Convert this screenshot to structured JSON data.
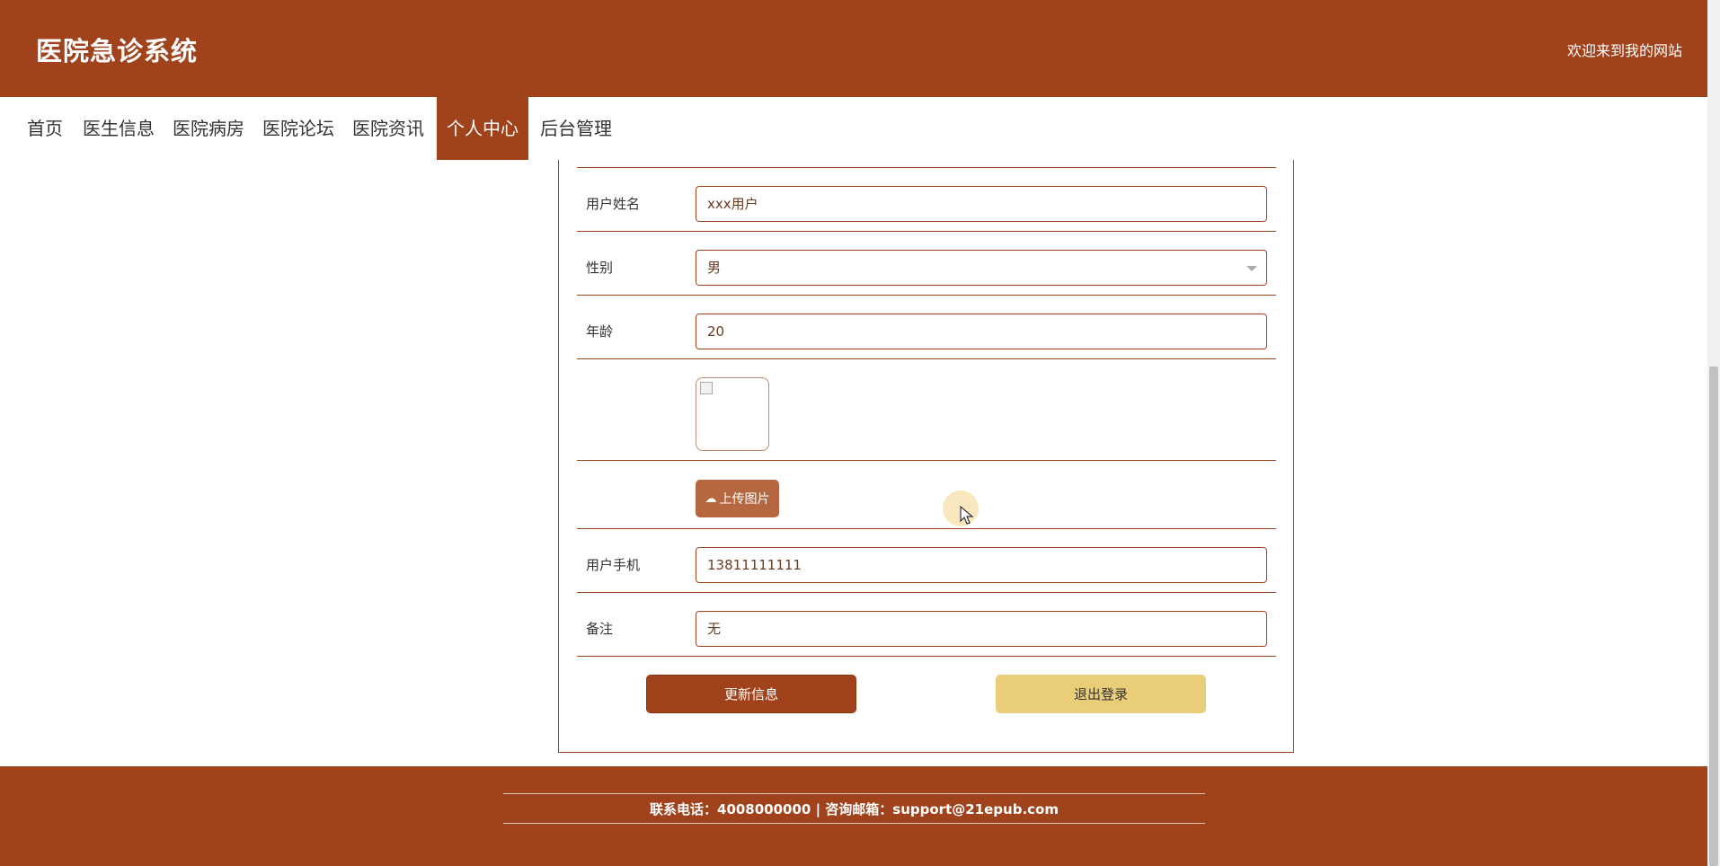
{
  "header": {
    "site_title": "医院急诊系统",
    "welcome": "欢迎来到我的网站"
  },
  "nav": {
    "items": [
      {
        "label": "首页"
      },
      {
        "label": "医生信息"
      },
      {
        "label": "医院病房"
      },
      {
        "label": "医院论坛"
      },
      {
        "label": "医院资讯"
      },
      {
        "label": "个人中心",
        "active": true
      },
      {
        "label": "后台管理"
      }
    ]
  },
  "form": {
    "name_label": "用户姓名",
    "name_value": "xxx用户",
    "gender_label": "性别",
    "gender_value": "男",
    "age_label": "年龄",
    "age_value": "20",
    "upload_label": "上传图片",
    "phone_label": "用户手机",
    "phone_value": "13811111111",
    "remark_label": "备注",
    "remark_value": "无",
    "update_label": "更新信息",
    "logout_label": "退出登录"
  },
  "footer": {
    "contact": "联系电话：4008000000 | 咨询邮箱：support@21epub.com"
  },
  "colors": {
    "brand": "#a0421b",
    "accent_yellow": "#e9cd79",
    "upload_button": "#b5683f"
  }
}
